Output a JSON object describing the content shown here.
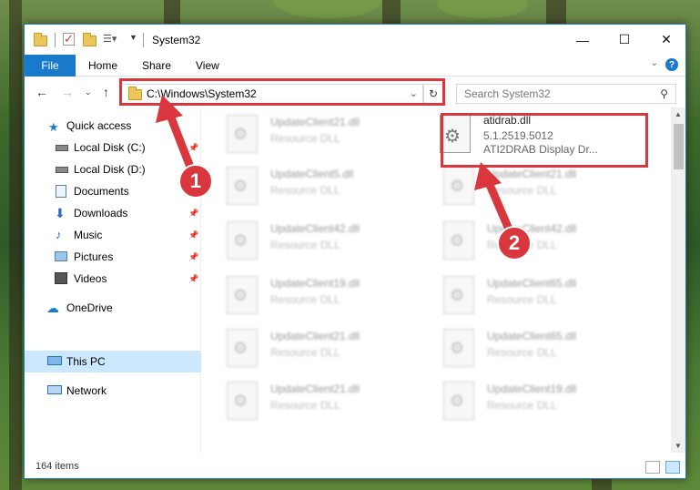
{
  "window": {
    "title": "System32"
  },
  "ribbon": {
    "tabs": [
      "File",
      "Home",
      "Share",
      "View"
    ]
  },
  "navigation": {
    "address": "C:\\Windows\\System32",
    "search_placeholder": "Search System32"
  },
  "sidebar": {
    "items": [
      {
        "label": "Quick access",
        "icon": "star-icon",
        "pinned": false
      },
      {
        "label": "Local Disk (C:)",
        "icon": "drive-icon",
        "pinned": true
      },
      {
        "label": "Local Disk (D:)",
        "icon": "drive-icon",
        "pinned": false
      },
      {
        "label": "Documents",
        "icon": "document-icon",
        "pinned": true
      },
      {
        "label": "Downloads",
        "icon": "download-icon",
        "pinned": true
      },
      {
        "label": "Music",
        "icon": "music-icon",
        "pinned": true
      },
      {
        "label": "Pictures",
        "icon": "picture-icon",
        "pinned": true
      },
      {
        "label": "Videos",
        "icon": "video-icon",
        "pinned": true
      },
      {
        "label": "OneDrive",
        "icon": "cloud-icon",
        "pinned": false
      },
      {
        "label": "This PC",
        "icon": "computer-icon",
        "pinned": false
      },
      {
        "label": "Network",
        "icon": "network-icon",
        "pinned": false
      }
    ]
  },
  "files": {
    "highlighted": {
      "name": "atidrab.dll",
      "version": "5.1.2519.5012",
      "description": "ATI2DRAB Display Dr..."
    },
    "left_column": [
      {
        "name": "UpdateClient21.dll",
        "type": "Resource DLL"
      },
      {
        "name": "UpdateClient5.dll",
        "type": "Resource DLL"
      },
      {
        "name": "UpdateClient42.dll",
        "type": "Resource DLL"
      },
      {
        "name": "UpdateClient19.dll",
        "type": "Resource DLL"
      },
      {
        "name": "UpdateClient21.dll",
        "type": "Resource DLL"
      },
      {
        "name": "UpdateClient21.dll",
        "type": "Resource DLL"
      }
    ],
    "right_column": [
      {
        "name": "UpdateClient21.dll",
        "type": "Resource DLL"
      },
      {
        "name": "UpdateClient42.dll",
        "type": "Resource DLL"
      },
      {
        "name": "UpdateClient65.dll",
        "type": "Resource DLL"
      },
      {
        "name": "UpdateClient65.dll",
        "type": "Resource DLL"
      },
      {
        "name": "UpdateClient19.dll",
        "type": "Resource DLL"
      }
    ]
  },
  "status": {
    "item_count": "164 items"
  },
  "annotations": {
    "step1": "1",
    "step2": "2",
    "highlight_color": "#d9363e"
  },
  "colors": {
    "accent": "#1979ca",
    "selection": "#cce8ff"
  }
}
